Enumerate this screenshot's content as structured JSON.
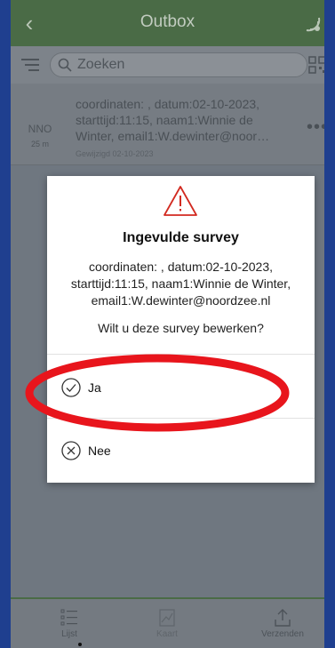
{
  "header": {
    "title": "Outbox"
  },
  "search": {
    "placeholder": "Zoeken"
  },
  "list": {
    "items": [
      {
        "direction": "NNO",
        "distance": "25 m",
        "line1": "coordinaten: , datum:02-10-2023,",
        "line2": "starttijd:11:15, naam1:Winnie de",
        "line3": "Winter, email1:W.dewinter@noor…",
        "modified": "Gewijzigd 02-10-2023"
      }
    ]
  },
  "dialog": {
    "title": "Ingevulde survey",
    "body_lines": [
      "coordinaten: , datum:02-10-2023,",
      "starttijd:11:15, naam1:Winnie de Winter,",
      "email1:W.dewinter@noordzee.nl"
    ],
    "question": "Wilt u deze survey bewerken?",
    "options": [
      {
        "label": "Ja",
        "icon": "check-circle-icon"
      },
      {
        "label": "Nee",
        "icon": "x-circle-icon"
      }
    ]
  },
  "tabs": [
    {
      "label": "Lijst",
      "icon": "list-icon",
      "active": true
    },
    {
      "label": "Kaart",
      "icon": "map-icon",
      "active": false
    },
    {
      "label": "Verzenden",
      "icon": "send-icon",
      "active": false
    }
  ],
  "colors": {
    "header": "#4a6b46",
    "backdrop": "#1f3f8f",
    "highlight": "#e8151c"
  }
}
